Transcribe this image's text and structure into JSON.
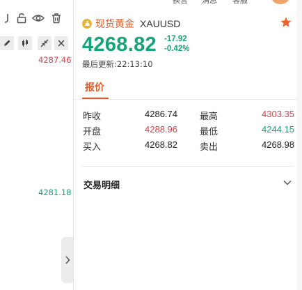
{
  "top_nav": {
    "items": [
      "换言",
      "消息",
      "客服"
    ]
  },
  "chart": {
    "price_high_label": "4287.46",
    "price_low_label": "4281.18",
    "toolbar_icons": [
      "undo-icon",
      "unlock-icon",
      "eye-icon",
      "trash-icon"
    ],
    "tool_buttons": [
      "pencil-icon",
      "candles-icon",
      "shrink-icon",
      "close-icon"
    ]
  },
  "quote": {
    "name": "现货黄金",
    "symbol": "XAUUSD",
    "price": "4268.82",
    "change": "-17.92",
    "change_pct": "-0.42%",
    "updated": "最后更新:22:13:10",
    "tab_label": "报价",
    "stats": {
      "prev_close_label": "昨收",
      "prev_close": "4286.74",
      "high_label": "最高",
      "high": "4303.35",
      "open_label": "开盘",
      "open": "4288.96",
      "low_label": "最低",
      "low": "4244.15",
      "bid_label": "买入",
      "bid": "4268.82",
      "ask_label": "卖出",
      "ask": "4268.98"
    },
    "details_label": "交易明细"
  },
  "colors": {
    "accent": "#e05a28",
    "up": "#d8424a",
    "down": "#16a37b",
    "star": "#e8652d",
    "gold": "#e7b43a"
  }
}
